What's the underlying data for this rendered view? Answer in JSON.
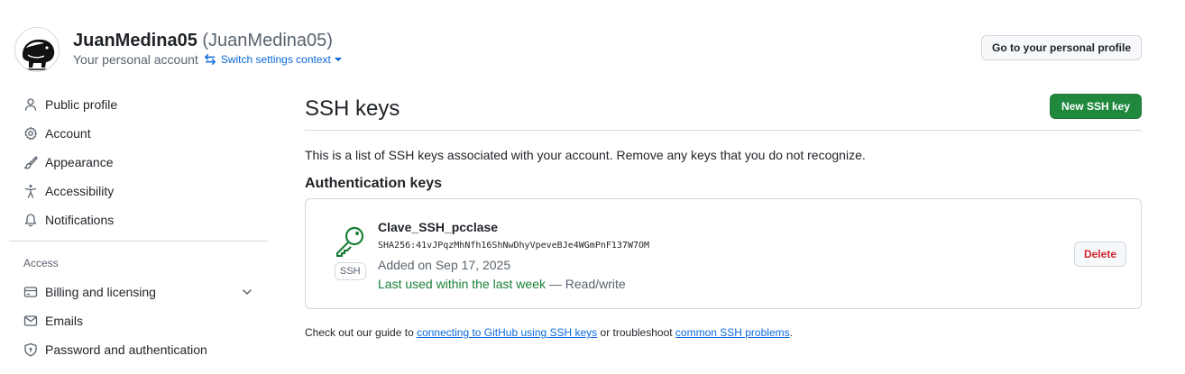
{
  "header": {
    "display_name": "JuanMedina05",
    "login": "(JuanMedina05)",
    "subtitle": "Your personal account",
    "switch_context": "Switch settings context",
    "profile_button": "Go to your personal profile"
  },
  "sidebar": {
    "items": [
      {
        "label": "Public profile",
        "icon": "person-icon"
      },
      {
        "label": "Account",
        "icon": "gear-icon"
      },
      {
        "label": "Appearance",
        "icon": "paintbrush-icon"
      },
      {
        "label": "Accessibility",
        "icon": "accessibility-icon"
      },
      {
        "label": "Notifications",
        "icon": "bell-icon"
      }
    ],
    "access_heading": "Access",
    "access_items": [
      {
        "label": "Billing and licensing",
        "icon": "credit-card-icon"
      },
      {
        "label": "Emails",
        "icon": "mail-icon"
      },
      {
        "label": "Password and authentication",
        "icon": "shield-lock-icon"
      }
    ]
  },
  "main": {
    "title": "SSH keys",
    "new_button": "New SSH key",
    "description": "This is a list of SSH keys associated with your account. Remove any keys that you do not recognize.",
    "section_title": "Authentication keys",
    "key": {
      "name": "Clave_SSH_pcclase",
      "fingerprint": "SHA256:41vJPqzMhNfh16ShNwDhyVpeveBJe4WGmPnF137W7OM",
      "badge": "SSH",
      "added": "Added on Sep 17, 2025",
      "last_used": "Last used within the last week",
      "access": "— Read/write",
      "delete_button": "Delete"
    },
    "footer": {
      "prefix": "Check out our guide to ",
      "link1": "connecting to GitHub using SSH keys",
      "middle": " or troubleshoot ",
      "link2": "common SSH problems",
      "suffix": "."
    }
  },
  "colors": {
    "primary_button": "#1f883d",
    "link": "#0969da",
    "danger": "#d1242f",
    "success_text": "#1a7f37"
  }
}
